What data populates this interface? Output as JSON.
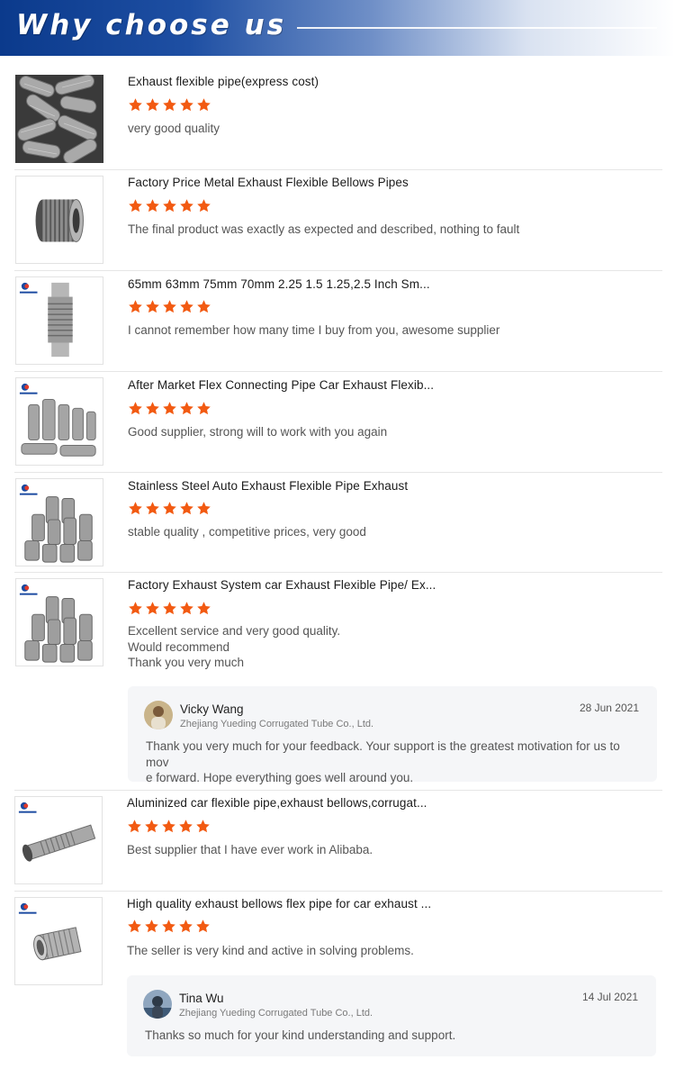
{
  "header": {
    "title": "Why choose us"
  },
  "colors": {
    "star": "#f25a12",
    "banner_dark": "#0b3a8c",
    "reply_bg": "#f5f6f8"
  },
  "reviews": [
    {
      "title": "Exhaust flexible pipe(express cost)",
      "stars": 5,
      "text": [
        "very good quality"
      ]
    },
    {
      "title": "Factory Price Metal Exhaust Flexible Bellows Pipes",
      "stars": 5,
      "text": [
        "The final product was exactly as expected and described, nothing to fault"
      ]
    },
    {
      "title": "65mm 63mm 75mm 70mm 2.25 1.5 1.25,2.5 Inch Sm...",
      "stars": 5,
      "text": [
        "I cannot remember how many time I buy from you, awesome supplier"
      ]
    },
    {
      "title": "After Market Flex Connecting Pipe Car Exhaust Flexib...",
      "stars": 5,
      "text": [
        "Good supplier, strong will to work with you again"
      ]
    },
    {
      "title": "Stainless Steel Auto Exhaust Flexible Pipe Exhaust",
      "stars": 5,
      "text": [
        "stable quality , competitive prices, very good"
      ]
    },
    {
      "title": "Factory Exhaust System car Exhaust Flexible Pipe/ Ex...",
      "stars": 5,
      "text": [
        "Excellent service and very good quality.",
        "Would recommend",
        "Thank you very much"
      ],
      "reply": {
        "name": "Vicky Wang",
        "company": "Zhejiang Yueding Corrugated Tube Co., Ltd.",
        "date": "28 Jun 2021",
        "text": [
          "Thank you very much for your feedback. Your support is the greatest motivation for us to mov",
          "e forward. Hope everything goes well around you."
        ]
      }
    },
    {
      "title": "Aluminized car flexible pipe,exhaust bellows,corrugat...",
      "stars": 5,
      "text": [
        "Best supplier that I have ever work in Alibaba."
      ]
    },
    {
      "title": "High quality exhaust bellows flex pipe for car exhaust ...",
      "stars": 5,
      "text": [
        "The seller is very kind and active in solving problems."
      ],
      "reply": {
        "name": "Tina Wu",
        "company": "Zhejiang Yueding Corrugated Tube Co., Ltd.",
        "date": "14 Jul 2021",
        "text": [
          "Thanks so much for your kind understanding and support."
        ]
      }
    }
  ]
}
